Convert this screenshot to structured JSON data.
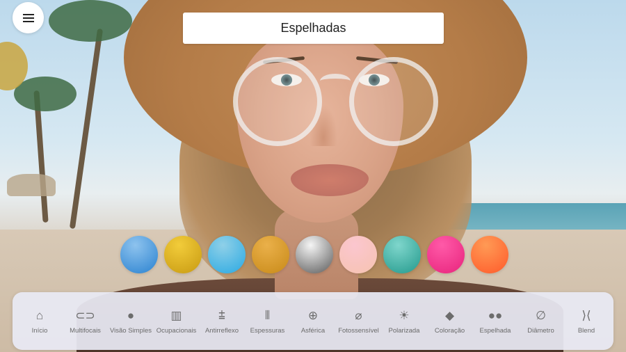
{
  "header": {
    "menu_icon": "hamburger-menu-icon",
    "title": "Espelhadas"
  },
  "swatches": [
    {
      "name": "blue",
      "from": "#8ec3ee",
      "to": "#2a82d0"
    },
    {
      "name": "gold",
      "from": "#f2cc3a",
      "to": "#c89a12"
    },
    {
      "name": "sky-blue",
      "from": "#8fd0e8",
      "to": "#2aa9e2"
    },
    {
      "name": "amber",
      "from": "#eab04a",
      "to": "#c88a18"
    },
    {
      "name": "silver",
      "from": "#f5f5f5",
      "to": "#5a5a5a"
    },
    {
      "name": "pink",
      "from": "#fbc6cf",
      "to": "#f6c3b0"
    },
    {
      "name": "teal",
      "from": "#7fd6cc",
      "to": "#23998c"
    },
    {
      "name": "magenta",
      "from": "#ff5aa8",
      "to": "#e8237c"
    },
    {
      "name": "orange",
      "from": "#ff9a55",
      "to": "#ff5a2a"
    }
  ],
  "toolbar": {
    "items": [
      {
        "label": "Início",
        "icon": "home-icon",
        "glyph": "⌂"
      },
      {
        "label": "Multifocais",
        "icon": "multifocal-lens-icon",
        "glyph": "⊂⊃"
      },
      {
        "label": "Visão Simples",
        "icon": "circle-icon",
        "glyph": "●"
      },
      {
        "label": "Ocupacionais",
        "icon": "occupational-icon",
        "glyph": "▥"
      },
      {
        "label": "Antirreflexo",
        "icon": "antireflex-icon",
        "glyph": "⩲"
      },
      {
        "label": "Espessuras",
        "icon": "thickness-icon",
        "glyph": "⦀"
      },
      {
        "label": "Asférica",
        "icon": "aspheric-grid-icon",
        "glyph": "⊕"
      },
      {
        "label": "Fotossensível",
        "icon": "photosensitive-icon",
        "glyph": "⌀"
      },
      {
        "label": "Polarizada",
        "icon": "sun-icon",
        "glyph": "☀"
      },
      {
        "label": "Coloração",
        "icon": "paint-bucket-icon",
        "glyph": "◆"
      },
      {
        "label": "Espelhada",
        "icon": "sunglasses-icon",
        "glyph": "●●"
      },
      {
        "label": "Diâmetro",
        "icon": "diameter-icon",
        "glyph": "∅"
      },
      {
        "label": "Blend",
        "icon": "blend-icon",
        "glyph": "⟩⟨"
      }
    ]
  }
}
